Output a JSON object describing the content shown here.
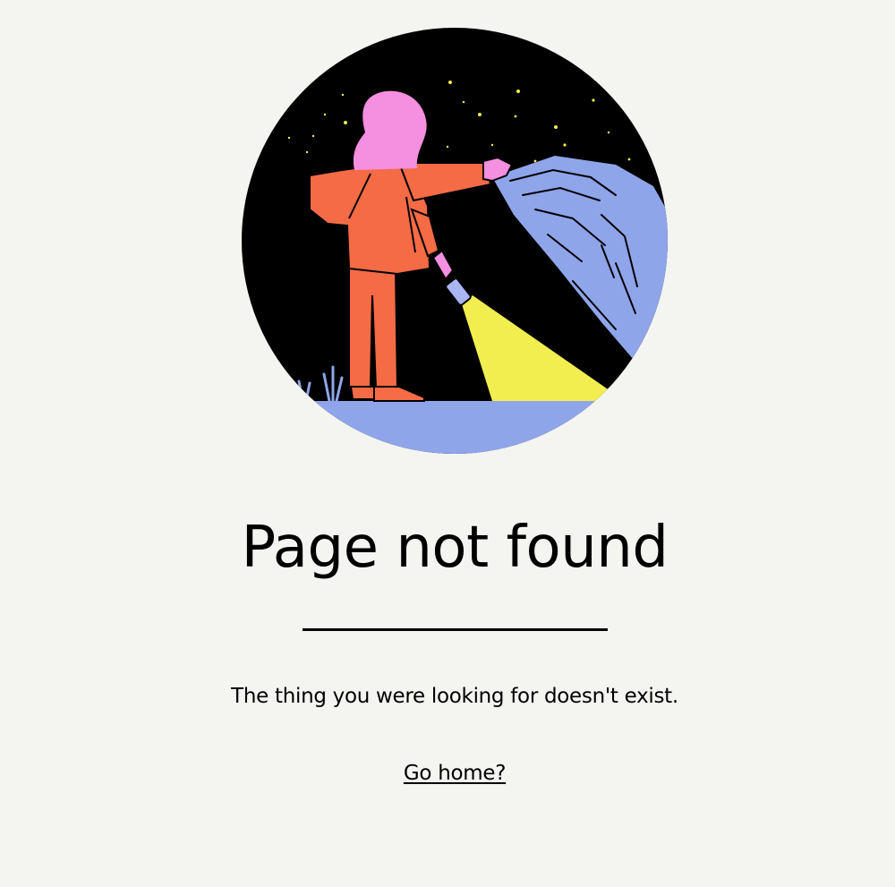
{
  "illustration": {
    "icon": "person-with-flashlight-illustration",
    "colors": {
      "sky": "#000000",
      "ground": "#8fa5ea",
      "rock": "#8fa5ea",
      "hair": "#f58fe0",
      "body": "#f46b45",
      "light_beam": "#f2ee50",
      "stars": "#f2ee50",
      "background": "#f4f4f1"
    }
  },
  "title": "Page not found",
  "message": "The thing you were looking for doesn't exist.",
  "home_link": "Go home?"
}
